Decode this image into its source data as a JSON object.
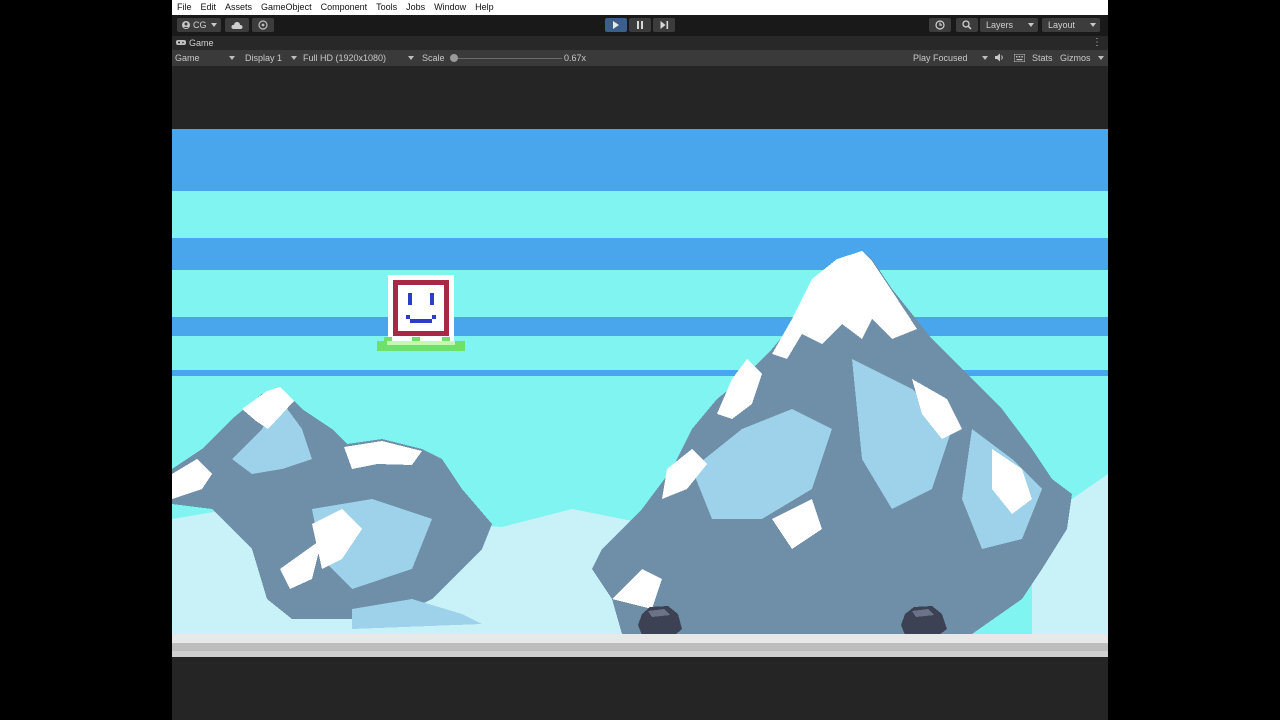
{
  "menu": [
    "File",
    "Edit",
    "Assets",
    "GameObject",
    "Component",
    "Tools",
    "Jobs",
    "Window",
    "Help"
  ],
  "toolbar": {
    "account_label": "CG",
    "layers_label": "Layers",
    "layout_label": "Layout",
    "play_state": "playing"
  },
  "tab": {
    "title": "Game"
  },
  "game_bar": {
    "view_mode": "Game",
    "display": "Display 1",
    "resolution": "Full HD (1920x1080)",
    "scale_label": "Scale",
    "scale_value": "0.67x",
    "scale_fraction": 0.0,
    "play_mode": "Play Focused",
    "stats_label": "Stats",
    "gizmos_label": "Gizmos"
  },
  "scene": {
    "sky_dark": "#4aa6ec",
    "sky_light": "#7ff4f0",
    "snow": "#ffffff",
    "rock": "#6f8ea8",
    "ice": "#9ed2ea",
    "ground": "#e8e8e8",
    "player_frame": "#a82848",
    "player_face": "#2a3cc8",
    "grass": "#6fe06a"
  }
}
